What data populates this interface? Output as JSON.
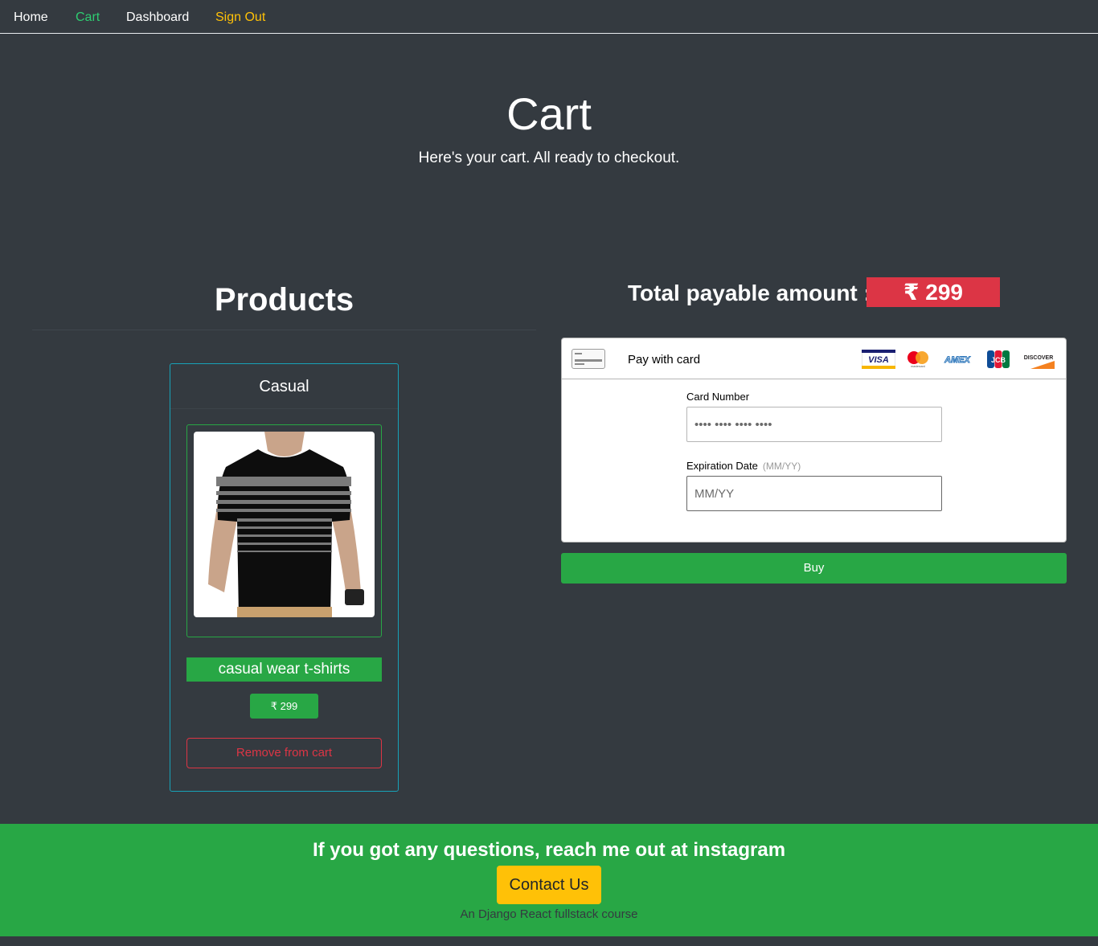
{
  "nav": {
    "items": [
      {
        "label": "Home",
        "color": "#ffffff"
      },
      {
        "label": "Cart",
        "color": "#2ecc71"
      },
      {
        "label": "Dashboard",
        "color": "#ffffff"
      },
      {
        "label": "Sign Out",
        "color": "#ffc107"
      }
    ]
  },
  "hero": {
    "title": "Cart",
    "subtitle": "Here's your cart. All ready to checkout."
  },
  "products": {
    "heading": "Products",
    "items": [
      {
        "category": "Casual",
        "name": "casual wear t-shirts",
        "price": "₹ 299",
        "remove_label": "Remove from cart"
      }
    ]
  },
  "checkout": {
    "total_label": "Total payable amount :",
    "total_value": "₹ 299",
    "pay_label": "Pay with card",
    "card_brands": [
      "VISA",
      "mastercard",
      "AMEX",
      "JCB",
      "DISCOVER"
    ],
    "card_number_label": "Card Number",
    "card_number_placeholder": "•••• •••• •••• ••••",
    "expiration_label": "Expiration Date",
    "expiration_hint": "(MM/YY)",
    "expiration_placeholder": "MM/YY",
    "buy_label": "Buy"
  },
  "footer": {
    "question": "If you got any questions, reach me out at instagram",
    "contact_label": "Contact Us",
    "tagline": "An Django React fullstack course"
  },
  "colors": {
    "background": "#343a40",
    "success": "#28a745",
    "danger": "#dc3545",
    "warning": "#ffc107",
    "info": "#17a2b8"
  }
}
